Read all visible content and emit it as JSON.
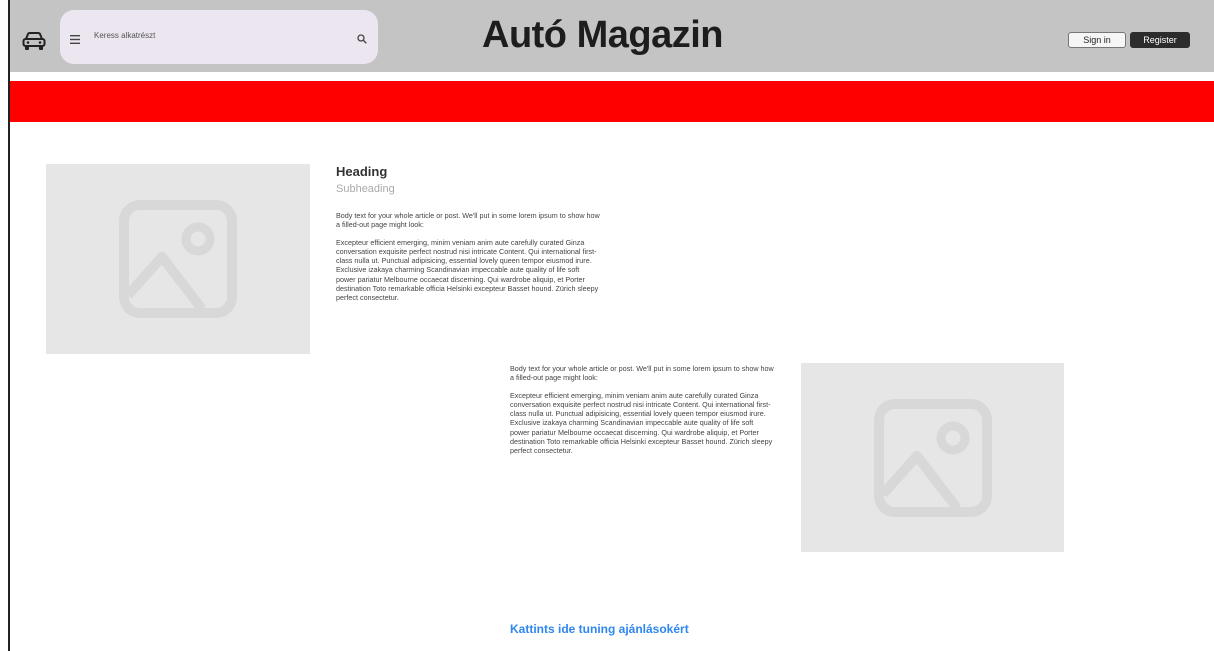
{
  "header": {
    "site_title": "Autó Magazin",
    "search_placeholder": "Keress alkatrészt",
    "sign_in_label": "Sign in",
    "register_label": "Register",
    "icons": {
      "logo": "car-icon",
      "menu": "hamburger-icon",
      "search": "search-icon"
    }
  },
  "colors": {
    "header_bg": "#c4c4c4",
    "banner": "#ff0000",
    "search_bg": "#ece6f0",
    "link": "#2e86f0",
    "register_bg": "#2c2c2c"
  },
  "article": {
    "heading": "Heading",
    "subheading": "Subheading",
    "body_1": {
      "intro": "Body text for your whole article or post. We'll put in some lorem ipsum to show how a filled-out page might look:",
      "content": "Excepteur efficient emerging, minim veniam anim aute carefully curated Ginza conversation exquisite perfect nostrud nisi intricate Content. Qui  international first-class nulla ut. Punctual adipisicing, essential lovely queen tempor eiusmod irure. Exclusive izakaya charming Scandinavian impeccable aute quality of life soft power pariatur Melbourne occaecat discerning. Qui wardrobe aliquip, et Porter destination Toto remarkable officia Helsinki excepteur Basset hound. Zürich sleepy perfect consectetur."
    },
    "body_2": {
      "intro": "Body text for your whole article or post. We'll put in some lorem ipsum to show how a filled-out page might look:",
      "content": "Excepteur efficient emerging, minim veniam anim aute carefully curated Ginza conversation exquisite perfect nostrud nisi intricate Content. Qui  international first-class nulla ut. Punctual adipisicing, essential lovely queen tempor eiusmod irure. Exclusive izakaya charming Scandinavian impeccable aute quality of life soft power pariatur Melbourne occaecat discerning. Qui wardrobe aliquip, et Porter destination Toto remarkable officia Helsinki excepteur Basset hound. Zürich sleepy perfect consectetur."
    },
    "images": [
      "image-placeholder-icon",
      "image-placeholder-icon"
    ]
  },
  "cta": {
    "label": "Kattints ide tuning ajánlásokért"
  }
}
